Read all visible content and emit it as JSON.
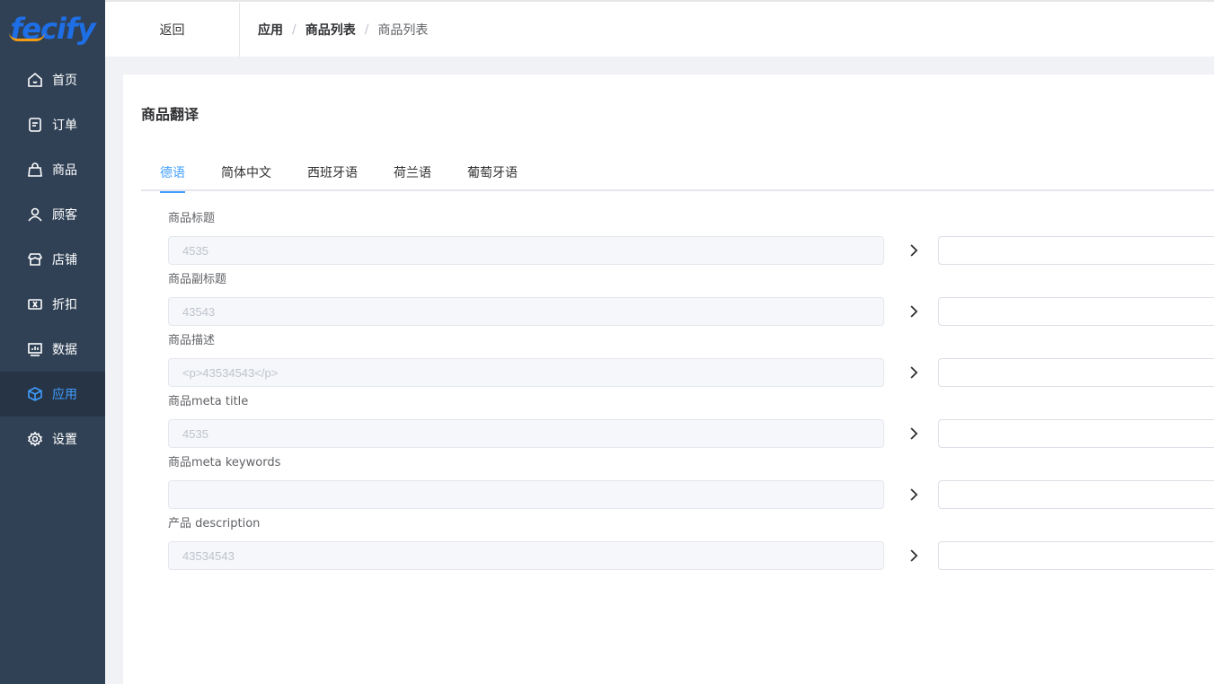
{
  "logo": {
    "text": "fecify"
  },
  "sidebar": {
    "items": [
      {
        "label": "首页",
        "icon": "home-icon",
        "active": false
      },
      {
        "label": "订单",
        "icon": "order-icon",
        "active": false
      },
      {
        "label": "商品",
        "icon": "bag-icon",
        "active": false
      },
      {
        "label": "顾客",
        "icon": "user-icon",
        "active": false
      },
      {
        "label": "店铺",
        "icon": "store-icon",
        "active": false
      },
      {
        "label": "折扣",
        "icon": "ticket-icon",
        "active": false
      },
      {
        "label": "数据",
        "icon": "chart-icon",
        "active": false
      },
      {
        "label": "应用",
        "icon": "cube-icon",
        "active": true
      },
      {
        "label": "设置",
        "icon": "gear-icon",
        "active": false
      }
    ]
  },
  "header": {
    "back": "返回",
    "breadcrumb": [
      "应用",
      "商品列表",
      "商品列表"
    ],
    "separator": "/"
  },
  "main": {
    "title": "商品翻译",
    "tabs": [
      "德语",
      "简体中文",
      "西班牙语",
      "荷兰语",
      "葡萄牙语"
    ],
    "active_tab": 0,
    "fields": [
      {
        "label": "商品标题",
        "source_value": "4535",
        "target_value": ""
      },
      {
        "label": "商品副标题",
        "source_value": "43543",
        "target_value": ""
      },
      {
        "label": "商品描述",
        "source_value": "<p>43534543</p>",
        "target_value": ""
      },
      {
        "label": "商品meta title",
        "source_value": "4535",
        "target_value": ""
      },
      {
        "label": "商品meta keywords",
        "source_value": "",
        "target_value": ""
      },
      {
        "label": "产品 description",
        "source_value": "43534543",
        "target_value": ""
      }
    ]
  },
  "colors": {
    "sidebar_bg": "#304156",
    "accent": "#409eff",
    "logo_blue": "#1e6fe6",
    "logo_orange": "#f39c12"
  }
}
